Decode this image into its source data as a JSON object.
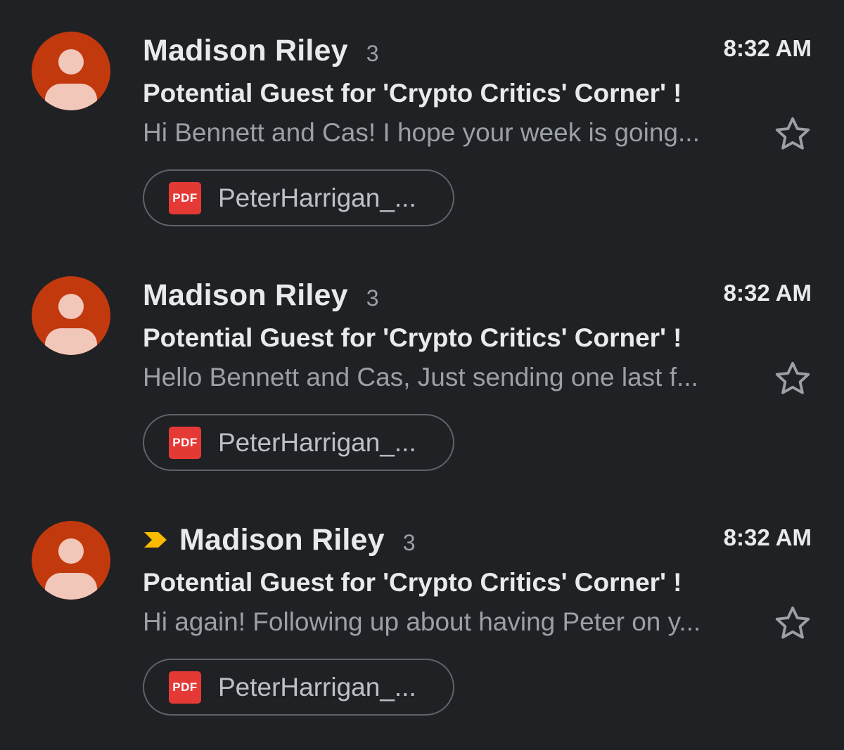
{
  "emails": [
    {
      "sender": "Madison Riley",
      "count": "3",
      "time": "8:32 AM",
      "subject": "Potential Guest for 'Crypto Critics' Corner' !",
      "snippet": "Hi Bennett and Cas! I hope your week is going...",
      "attachment": {
        "type_label": "PDF",
        "name": "PeterHarrigan_..."
      },
      "important": false,
      "starred": false
    },
    {
      "sender": "Madison Riley",
      "count": "3",
      "time": "8:32 AM",
      "subject": "Potential Guest for 'Crypto Critics' Corner' !",
      "snippet": "Hello Bennett and Cas, Just sending one last f...",
      "attachment": {
        "type_label": "PDF",
        "name": "PeterHarrigan_..."
      },
      "important": false,
      "starred": false
    },
    {
      "sender": "Madison Riley",
      "count": "3",
      "time": "8:32 AM",
      "subject": "Potential Guest for 'Crypto Critics' Corner' !",
      "snippet": "Hi again! Following up about having Peter on y...",
      "attachment": {
        "type_label": "PDF",
        "name": "PeterHarrigan_..."
      },
      "important": true,
      "starred": false
    }
  ],
  "colors": {
    "background": "#202124",
    "avatar": "#c2390e",
    "avatar_figure": "#f1c7ba",
    "important_marker": "#f9ba00",
    "pdf_icon": "#e53935"
  },
  "icons": {
    "avatar": "person-avatar-icon",
    "important": "important-marker-icon",
    "star": "star-outline-icon",
    "attachment": "pdf-file-icon"
  }
}
